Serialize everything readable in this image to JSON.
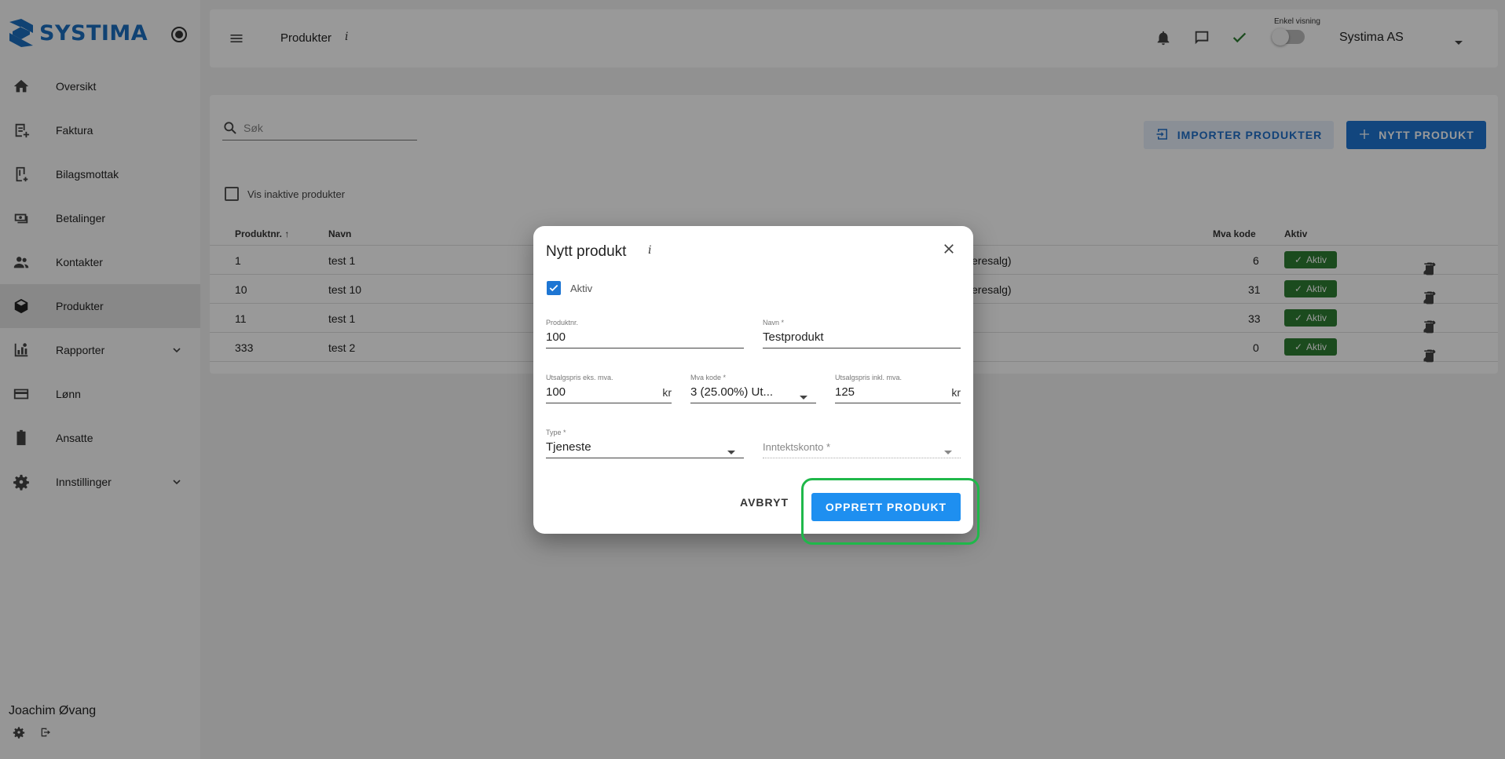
{
  "sidebar": {
    "logo": "SYSTIMA",
    "items": [
      {
        "label": "Oversikt",
        "icon": "home-icon"
      },
      {
        "label": "Faktura",
        "icon": "invoice-icon"
      },
      {
        "label": "Bilagsmottak",
        "icon": "receipt-icon"
      },
      {
        "label": "Betalinger",
        "icon": "payments-icon"
      },
      {
        "label": "Kontakter",
        "icon": "contacts-icon"
      },
      {
        "label": "Produkter",
        "icon": "box-icon",
        "active": true
      },
      {
        "label": "Rapporter",
        "icon": "report-icon",
        "expandable": true
      },
      {
        "label": "Lønn",
        "icon": "card-icon"
      },
      {
        "label": "Ansatte",
        "icon": "badge-icon"
      },
      {
        "label": "Innstillinger",
        "icon": "gear-icon",
        "expandable": true
      }
    ],
    "user_name": "Joachim Øvang"
  },
  "topbar": {
    "title": "Produkter",
    "info": "i",
    "enkel_visning_label": "Enkel visning",
    "company": "Systima AS"
  },
  "content": {
    "search_placeholder": "Søk",
    "import_button": "IMPORTER PRODUKTER",
    "new_button": "NYTT PRODUKT",
    "vis_inaktive_label": "Vis inaktive produkter",
    "table": {
      "headers": {
        "produktnr": "Produktnr.",
        "navn": "Navn",
        "mva_kode": "Mva kode",
        "aktiv": "Aktiv"
      },
      "rows": [
        {
          "produktnr": "1",
          "navn": "test 1",
          "partial": "eresalg)",
          "mva_kode": "6",
          "aktiv": "Aktiv"
        },
        {
          "produktnr": "10",
          "navn": "test 10",
          "partial": "eresalg)",
          "mva_kode": "31",
          "aktiv": "Aktiv"
        },
        {
          "produktnr": "11",
          "navn": "test 1",
          "partial": "",
          "mva_kode": "33",
          "aktiv": "Aktiv"
        },
        {
          "produktnr": "333",
          "navn": "test 2",
          "partial": "",
          "mva_kode": "0",
          "aktiv": "Aktiv"
        }
      ]
    }
  },
  "dialog": {
    "title": "Nytt produkt",
    "info": "i",
    "aktiv_label": "Aktiv",
    "produktnr": {
      "label": "Produktnr.",
      "value": "100"
    },
    "navn": {
      "label": "Navn *",
      "value": "Testprodukt"
    },
    "utsalgspris_eks": {
      "label": "Utsalgspris eks. mva.",
      "value": "100",
      "suffix": "kr"
    },
    "mva_kode": {
      "label": "Mva kode *",
      "value": "3 (25.00%) Ut..."
    },
    "utsalgspris_inkl": {
      "label": "Utsalgspris inkl. mva.",
      "value": "125",
      "suffix": "kr"
    },
    "type": {
      "label": "Type *",
      "value": "Tjeneste"
    },
    "inntektskonto": {
      "placeholder": "Inntektskonto *"
    },
    "cancel": "AVBRYT",
    "create": "OPPRETT PRODUKT"
  }
}
